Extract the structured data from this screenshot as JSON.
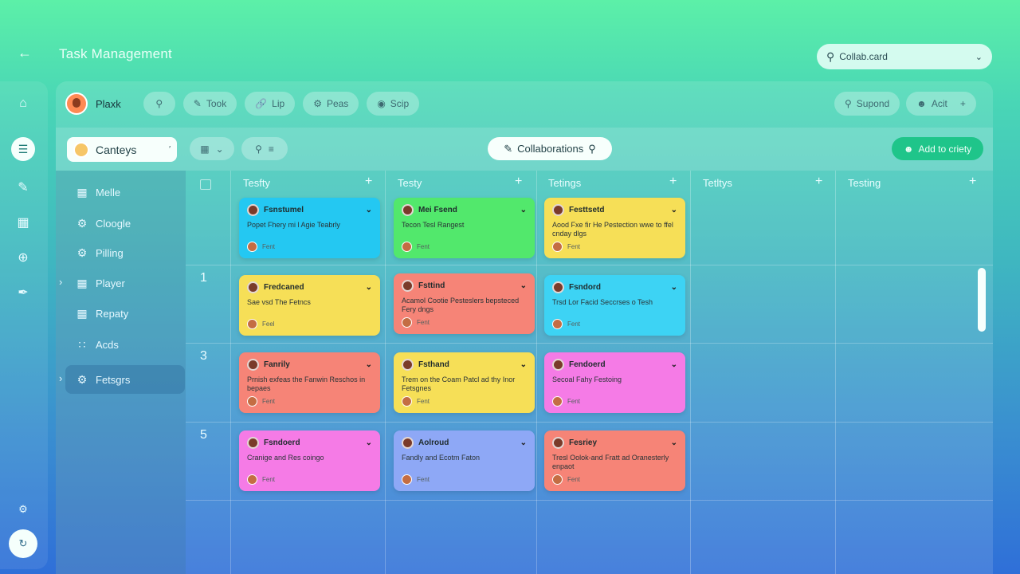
{
  "app": {
    "title": "Task Management",
    "top_search": "Collab.card"
  },
  "toolbar": {
    "user_name": "Plaxk",
    "pills": [
      "Took",
      "Lip",
      "Peas",
      "Scip"
    ],
    "right_pills": [
      "Supond",
      "Acit"
    ]
  },
  "filterbar": {
    "category": "Canteys",
    "collab_label": "Collaborations",
    "add_label": "Add to criety"
  },
  "sidebar": {
    "items": [
      {
        "label": "Melle",
        "icon": "grid-icon"
      },
      {
        "label": "Cloogle",
        "icon": "gear-icon"
      },
      {
        "label": "Pilling",
        "icon": "gear-icon"
      },
      {
        "label": "Player",
        "icon": "windows-icon"
      },
      {
        "label": "Repaty",
        "icon": "windows-icon"
      },
      {
        "label": "Acds",
        "icon": "dots-grid-icon"
      },
      {
        "label": "Fetsgrs",
        "icon": "gear-icon"
      }
    ]
  },
  "board": {
    "columns": [
      "Tesfty",
      "Testy",
      "Tetings",
      "Tetltys",
      "Testing"
    ],
    "rows": [
      "",
      "1",
      "3",
      "5"
    ],
    "cards": [
      {
        "title": "Fsnstumel",
        "body": "Popet Fhery mi l Agie Teabrly",
        "owner": "Fent",
        "color": "#24c8f2"
      },
      {
        "title": "Mei Fsend",
        "body": "Tecon Tesl Rangest",
        "owner": "Fent",
        "color": "#52e86c"
      },
      {
        "title": "Festtsetd",
        "body": "Aood Fxe fir He Pestection wwe to ffel cnday dlgs",
        "owner": "Fent",
        "color": "#f6df57"
      },
      {
        "title": "Fredcaned",
        "body": "Sae vsd The Fetncs",
        "owner": "Feel",
        "color": "#f6df57"
      },
      {
        "title": "Fsttind",
        "body": "Acamol Cootie Pesteslers bepsteced Fery dngs",
        "owner": "Fent",
        "color": "#f68477"
      },
      {
        "title": "Fsndord",
        "body": "Trsd Lor Facid Seccrses o Tesh",
        "owner": "Fent",
        "color": "#3dd3f4"
      },
      {
        "title": "Fanrily",
        "body": "Prnish exfeas the Fanwin Reschos in bepaes",
        "owner": "Fent",
        "color": "#f68477"
      },
      {
        "title": "Fsthand",
        "body": "Trem on the Coam Patcl ad thy Inor Fetsgnes",
        "owner": "Fent",
        "color": "#f6df57"
      },
      {
        "title": "Fendoerd",
        "body": "Secoal Fahy Festoing",
        "owner": "Fent",
        "color": "#f57be6"
      },
      {
        "title": "Fsndoerd",
        "body": "Cranige and Res coingo",
        "owner": "Fent",
        "color": "#f57be6"
      },
      {
        "title": "Aolroud",
        "body": "Fandly and Ecotm Faton",
        "owner": "Fent",
        "color": "#8ea8f6"
      },
      {
        "title": "Fesriey",
        "body": "Tresl Oolok-and Fratt ad Oranesterly enpaot",
        "owner": "Fent",
        "color": "#f68477"
      }
    ]
  }
}
